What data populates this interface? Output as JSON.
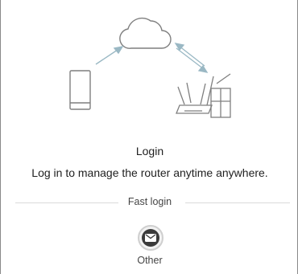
{
  "login": {
    "title": "Login",
    "subtitle": "Log in to manage the router anytime anywhere."
  },
  "fast_login": {
    "label": "Fast login",
    "options": [
      {
        "label": "Other",
        "icon": "envelope-icon"
      }
    ]
  },
  "illustration": {
    "icons": [
      "cloud-icon",
      "phone-icon",
      "router-icon",
      "arrow-icon"
    ]
  },
  "colors": {
    "line": "#7f7f7f",
    "arrow": "#9ab8c4",
    "text": "#1f1f1f"
  }
}
